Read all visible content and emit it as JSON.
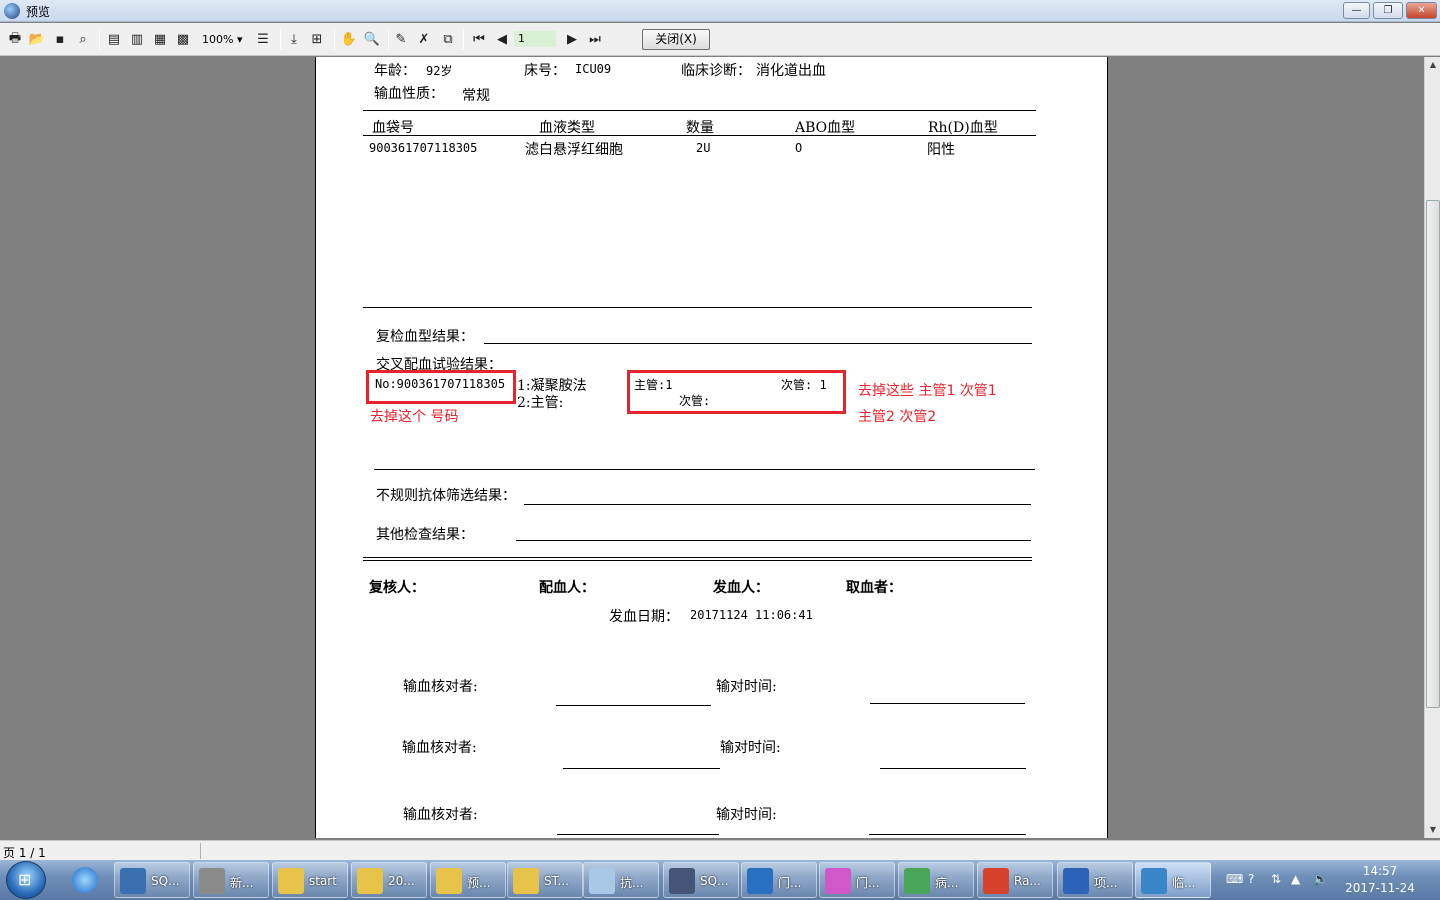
{
  "window": {
    "title": "预览",
    "min": "—",
    "max": "❐",
    "close": "✕"
  },
  "toolbar": {
    "zoom": "100%",
    "page_value": "1",
    "close_label": "关闭(X)",
    "icons": [
      "print-icon",
      "open-icon",
      "save-icon",
      "find-icon",
      "single-page-icon",
      "two-page-icon",
      "four-page-icon",
      "multi-page-icon",
      "zoom-dropdown",
      "page-width-icon",
      "export-icon",
      "outline-icon",
      "hand-icon",
      "zoom-icon",
      "edit-icon",
      "delete-icon",
      "copy-icon",
      "first-page-icon",
      "prev-page-icon",
      "next-page-icon",
      "last-page-icon"
    ]
  },
  "report": {
    "age_label": "年龄：",
    "age_value": "92岁",
    "bed_label": "床号：",
    "bed_value": "ICU09",
    "diagnosis_label": "临床诊断：",
    "diagnosis_value": "消化道出血",
    "nature_label": "输血性质：",
    "nature_value": "常规",
    "table": {
      "headers": [
        "血袋号",
        "血液类型",
        "数量",
        "ABO血型",
        "Rh(D)血型"
      ],
      "rows": [
        [
          "900361707118305",
          "滤白悬浮红细胞",
          "2U",
          "O",
          "阳性"
        ]
      ]
    },
    "recheck_label": "复检血型结果：",
    "cross_label": "交叉配血试验结果：",
    "cross_no": "No:900361707118305",
    "method_line1": "1:凝聚胺法",
    "method_line2": "2:主管:",
    "main_tube_1": "主管:1",
    "sub_tube_1": "次管: 1",
    "sub_tube_2": "次管:",
    "irregular_label": "不规则抗体筛选结果：",
    "other_label": "其他检查结果：",
    "reviewer_label": "复核人：",
    "matcher_label": "配血人：",
    "issuer_label": "发血人：",
    "collector_label": "取血者：",
    "issue_date_label": "发血日期：",
    "issue_date_value": "20171124 11:06:41",
    "checker_label": "输血核对者:",
    "check_time_label": "输对时间:"
  },
  "annotations": {
    "note_left": "去掉这个 号码",
    "note_right_1": "去掉这些  主管1 次管1",
    "note_right_2": "主管2 次管2"
  },
  "status": {
    "page_info": "页 1 / 1"
  },
  "taskbar": {
    "items": [
      {
        "label": "SQ...",
        "color": "#3a6fb0"
      },
      {
        "label": "新...",
        "color": "#8a8a8a"
      },
      {
        "label": "start",
        "color": "#e8c34a"
      },
      {
        "label": "20...",
        "color": "#e8c34a"
      },
      {
        "label": "预...",
        "color": "#e8c34a"
      },
      {
        "label": "ST...",
        "color": "#e8c34a"
      },
      {
        "label": "抗...",
        "color": "#a9c7e6"
      },
      {
        "label": "SQ...",
        "color": "#445577"
      },
      {
        "label": "门...",
        "color": "#2a70c0"
      },
      {
        "label": "门...",
        "color": "#d058c8"
      },
      {
        "label": "病...",
        "color": "#49a558"
      },
      {
        "label": "Ra...",
        "color": "#d8412b"
      },
      {
        "label": "项...",
        "color": "#2c62b8"
      },
      {
        "label": "临...",
        "color": "#3a86c8"
      }
    ],
    "time": "14:57",
    "date": "2017-11-24"
  }
}
